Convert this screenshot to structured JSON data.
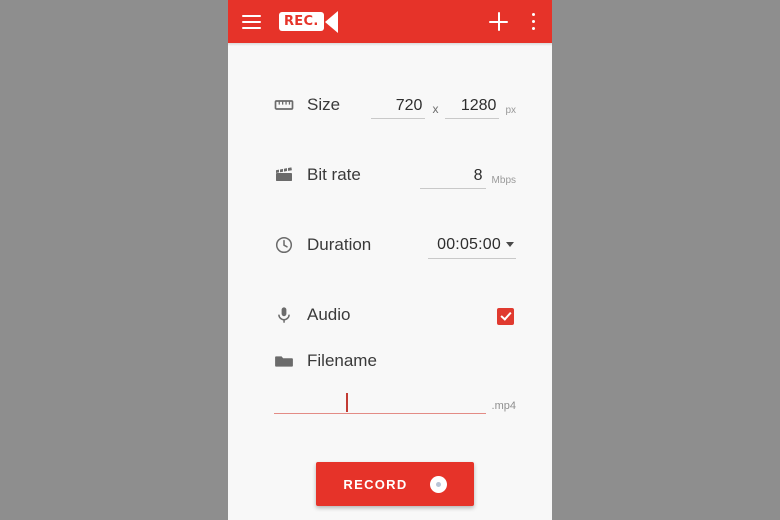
{
  "theme": {
    "accent": "#e63329",
    "checkbox": "#e03a2f",
    "page_bg": "#f8f8f8",
    "letterbox_bg": "#8e8e8e",
    "label_color": "#3a3a3a",
    "underline_color": "#c9c9c9",
    "filename_underline": "#e38b85"
  },
  "appbar": {
    "menu_icon": "hamburger-menu-icon",
    "logo_text": "REC.",
    "logo_lens_icon": "video-camera-lens-icon",
    "add_icon": "plus-icon",
    "overflow_icon": "more-vertical-icon"
  },
  "form": {
    "size": {
      "icon": "ruler-icon",
      "label": "Size",
      "width": "720",
      "separator": "x",
      "height": "1280",
      "unit": "px"
    },
    "bitrate": {
      "icon": "clapperboard-icon",
      "label": "Bit rate",
      "value": "8",
      "unit": "Mbps"
    },
    "duration": {
      "icon": "clock-icon",
      "label": "Duration",
      "value": "00:05:00",
      "caret_icon": "chevron-down-icon"
    },
    "audio": {
      "icon": "microphone-icon",
      "label": "Audio",
      "checked": true
    },
    "filename": {
      "icon": "folder-icon",
      "label": "Filename",
      "value": "",
      "placeholder": "",
      "extension": ".mp4"
    }
  },
  "record_button": {
    "label": "RECORD",
    "icon": "record-circle-icon"
  }
}
